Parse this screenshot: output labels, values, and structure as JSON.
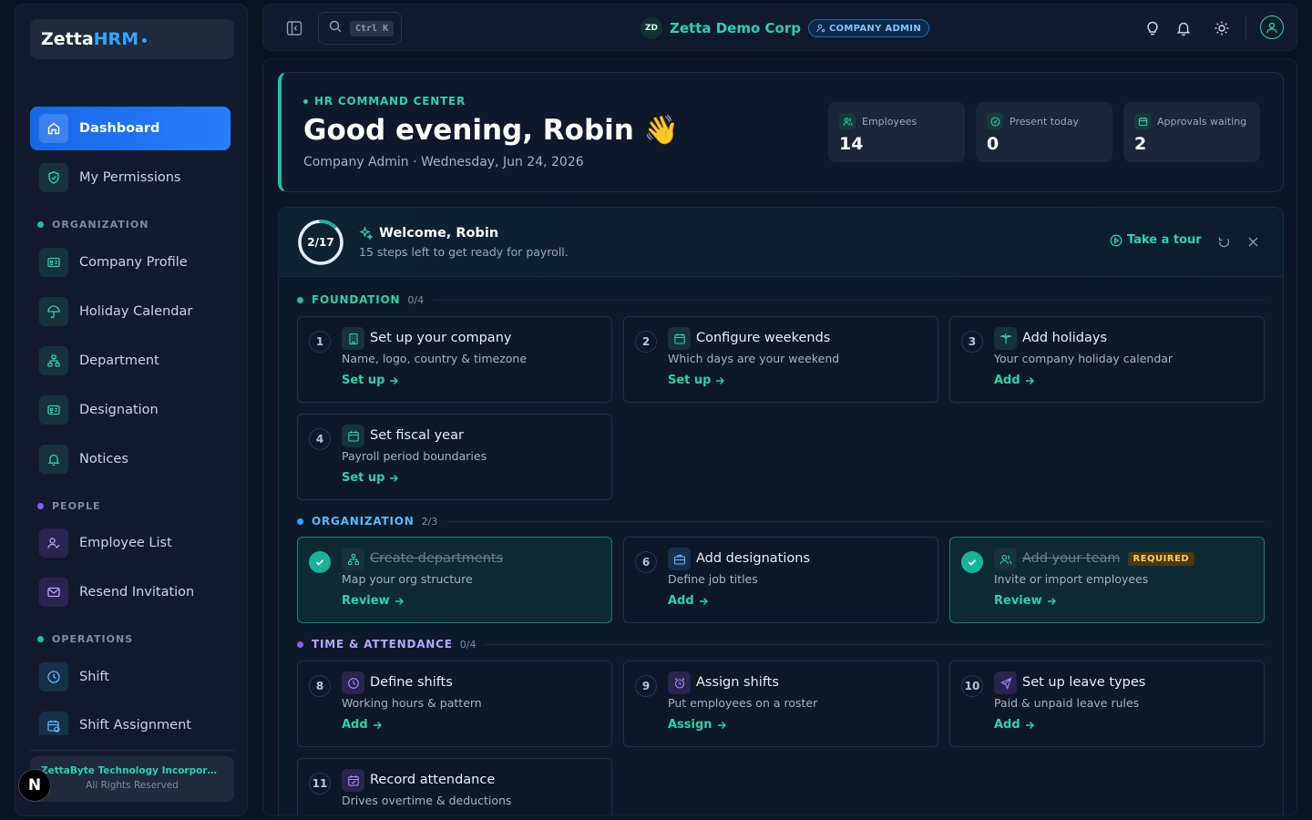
{
  "brand": {
    "part1": "Zetta",
    "part2": "HRM"
  },
  "sidebar": {
    "top_items": [
      {
        "label": "Dashboard",
        "icon": "home-icon"
      },
      {
        "label": "My Permissions",
        "icon": "shield-check-icon"
      }
    ],
    "sections": [
      {
        "title": "ORGANIZATION",
        "color": "#1ec2a5",
        "items": [
          "Company Profile",
          "Holiday Calendar",
          "Department",
          "Designation",
          "Notices"
        ]
      },
      {
        "title": "PEOPLE",
        "color": "#8b5cf6",
        "items": [
          "Employee List",
          "Resend Invitation"
        ]
      },
      {
        "title": "OPERATIONS",
        "color": "#1ec2a5",
        "items": [
          "Shift",
          "Shift Assignment"
        ]
      }
    ],
    "footer": {
      "company": "ZettaByte Technology Incorporat...",
      "rights": "All Rights Reserved"
    },
    "badge": "N"
  },
  "topbar": {
    "search_shortcut": "Ctrl K",
    "company_initials": "ZD",
    "company_name": "Zetta Demo Corp",
    "role_badge": "COMPANY ADMIN"
  },
  "hero": {
    "tag": "HR COMMAND CENTER",
    "greeting": "Good evening, Robin 👋",
    "subtitle": "Company Admin · Wednesday, Jun 24, 2026",
    "stats": [
      {
        "label": "Employees",
        "value": "14",
        "icon": "users-icon"
      },
      {
        "label": "Present today",
        "value": "0",
        "icon": "check-circle-icon"
      },
      {
        "label": "Approvals waiting",
        "value": "2",
        "icon": "calendar-icon"
      }
    ]
  },
  "wizard": {
    "progress_label": "2/17",
    "progress_fraction": 0.1176,
    "title": "Welcome, Robin",
    "subtitle": "15 steps left to get ready for payroll.",
    "tour_label": "Take a tour",
    "groups": [
      {
        "name": "FOUNDATION",
        "count": "0/4",
        "color": "#1ec2a5"
      },
      {
        "name": "ORGANIZATION",
        "count": "2/3",
        "color": "#2ea8ff"
      },
      {
        "name": "TIME & ATTENDANCE",
        "count": "0/4",
        "color": "#8b5cf6"
      }
    ],
    "steps": [
      {
        "num": "1",
        "title": "Set up your company",
        "desc": "Name, logo, country & timezone",
        "action": "Set up",
        "icon": "building-icon",
        "done": false
      },
      {
        "num": "2",
        "title": "Configure weekends",
        "desc": "Which days are your weekend",
        "action": "Set up",
        "icon": "calendar-icon",
        "done": false
      },
      {
        "num": "3",
        "title": "Add holidays",
        "desc": "Your company holiday calendar",
        "action": "Add",
        "icon": "palm-tree-icon",
        "done": false
      },
      {
        "num": "4",
        "title": "Set fiscal year",
        "desc": "Payroll period boundaries",
        "action": "Set up",
        "icon": "calendar-icon",
        "done": false
      },
      {
        "num": "5",
        "title": "Create departments",
        "desc": "Map your org structure",
        "action": "Review",
        "icon": "org-chart-icon",
        "done": true
      },
      {
        "num": "6",
        "title": "Add designations",
        "desc": "Define job titles",
        "action": "Add",
        "icon": "briefcase-icon",
        "done": false
      },
      {
        "num": "7",
        "title": "Add your team",
        "desc": "Invite or import employees",
        "action": "Review",
        "icon": "users-icon",
        "done": true,
        "badge": "REQUIRED"
      },
      {
        "num": "8",
        "title": "Define shifts",
        "desc": "Working hours & pattern",
        "action": "Add",
        "icon": "clock-icon",
        "done": false
      },
      {
        "num": "9",
        "title": "Assign shifts",
        "desc": "Put employees on a roster",
        "action": "Assign",
        "icon": "alarm-clock-icon",
        "done": false
      },
      {
        "num": "10",
        "title": "Set up leave types",
        "desc": "Paid & unpaid leave rules",
        "action": "Add",
        "icon": "plane-icon",
        "done": false
      },
      {
        "num": "11",
        "title": "Record attendance",
        "desc": "Drives overtime & deductions",
        "action": "",
        "icon": "calendar-check-icon",
        "done": false
      }
    ]
  }
}
